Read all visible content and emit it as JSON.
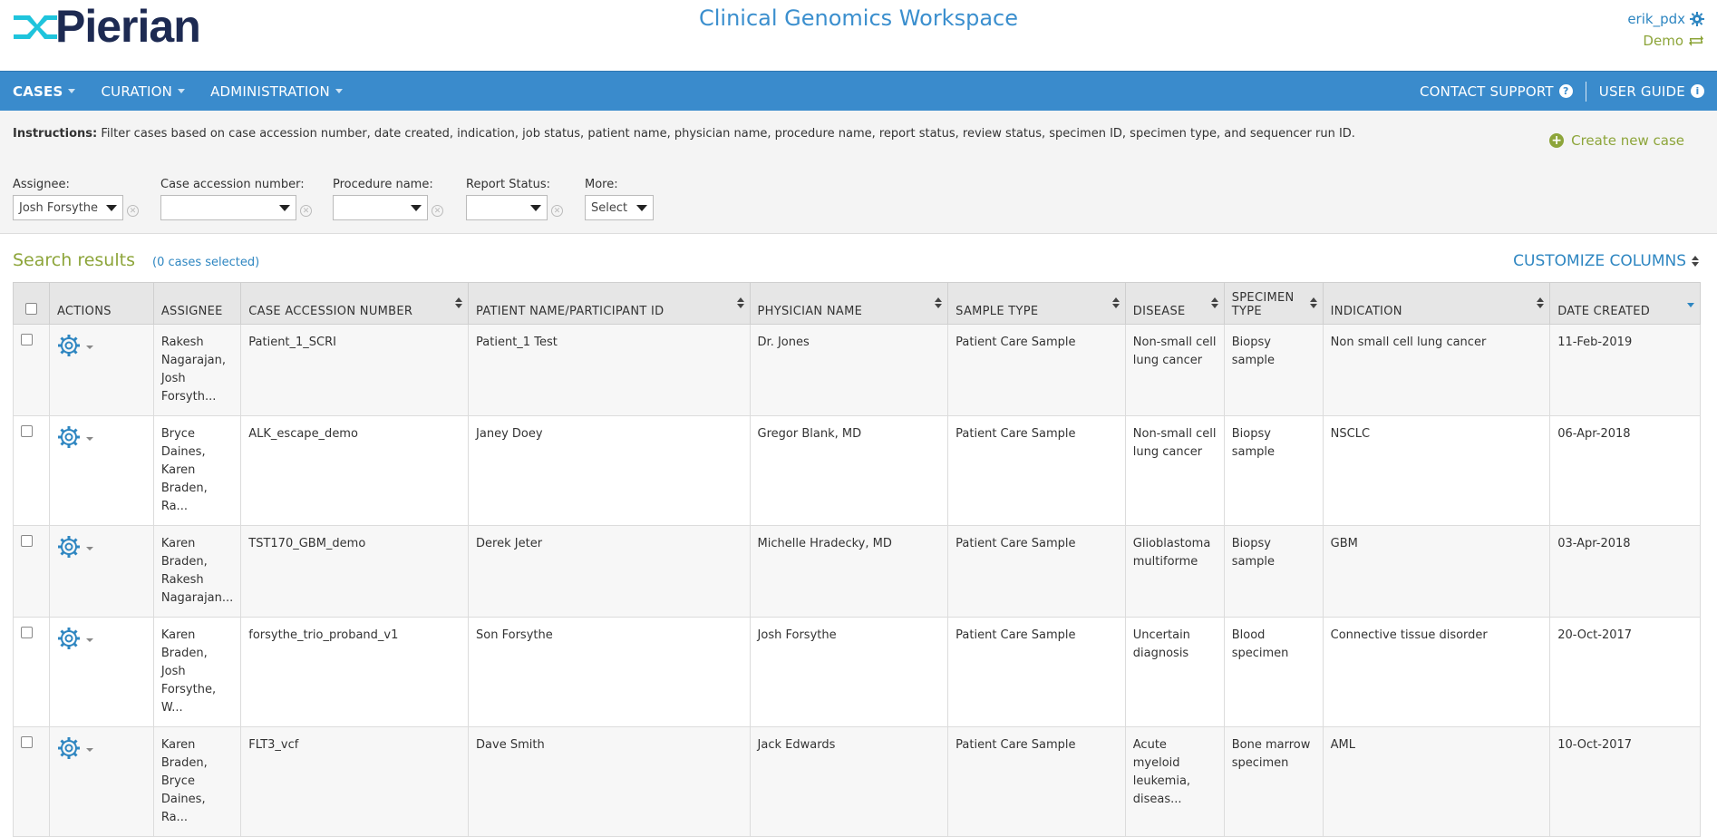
{
  "header": {
    "logo_text": "Pierian",
    "app_title": "Clinical Genomics Workspace",
    "username": "erik_pdx",
    "org": "Demo"
  },
  "nav": {
    "left": [
      {
        "label": "CASES",
        "active": true
      },
      {
        "label": "CURATION",
        "active": false
      },
      {
        "label": "ADMINISTRATION",
        "active": false
      }
    ],
    "contact_support": "CONTACT SUPPORT",
    "user_guide": "USER GUIDE"
  },
  "filters": {
    "instructions_label": "Instructions:",
    "instructions_text": "Filter cases based on case accession number, date created, indication, job status, patient name, physician name, procedure name, report status, review status, specimen ID, specimen type, and sequencer run ID.",
    "create_new": "Create new case",
    "assignee_label": "Assignee:",
    "assignee_value": "Josh Forsythe",
    "accession_label": "Case accession number:",
    "accession_value": "",
    "procedure_label": "Procedure name:",
    "procedure_value": "",
    "report_label": "Report Status:",
    "report_value": "",
    "more_label": "More:",
    "more_value": "Select"
  },
  "results": {
    "title": "Search results",
    "selected": "(0 cases selected)",
    "customize": "CUSTOMIZE COLUMNS"
  },
  "table": {
    "headers": {
      "actions": "ACTIONS",
      "assignee": "ASSIGNEE",
      "accession": "CASE ACCESSION NUMBER",
      "patient": "PATIENT NAME/PARTICIPANT ID",
      "physician": "PHYSICIAN NAME",
      "sample": "SAMPLE TYPE",
      "disease": "DISEASE",
      "specimen": "SPECIMEN TYPE",
      "indication": "INDICATION",
      "date": "DATE CREATED"
    },
    "rows": [
      {
        "assignee": "Rakesh Nagarajan, Josh Forsyth...",
        "accession": "Patient_1_SCRI",
        "patient": "Patient_1 Test",
        "physician": "Dr. Jones",
        "sample": "Patient Care Sample",
        "disease": "Non-small cell lung cancer",
        "specimen": "Biopsy sample",
        "indication": "Non small cell lung cancer",
        "date": "11-Feb-2019"
      },
      {
        "assignee": "Bryce Daines, Karen Braden, Ra...",
        "accession": "ALK_escape_demo",
        "patient": "Janey Doey",
        "physician": "Gregor Blank, MD",
        "sample": "Patient Care Sample",
        "disease": "Non-small cell lung cancer",
        "specimen": "Biopsy sample",
        "indication": "NSCLC",
        "date": "06-Apr-2018"
      },
      {
        "assignee": "Karen Braden, Rakesh Nagarajan...",
        "accession": "TST170_GBM_demo",
        "patient": "Derek Jeter",
        "physician": "Michelle Hradecky, MD",
        "sample": "Patient Care Sample",
        "disease": "Glioblastoma multiforme",
        "specimen": "Biopsy sample",
        "indication": "GBM",
        "date": "03-Apr-2018"
      },
      {
        "assignee": "Karen Braden, Josh Forsythe, W...",
        "accession": "forsythe_trio_proband_v1",
        "patient": "Son Forsythe",
        "physician": "Josh Forsythe",
        "sample": "Patient Care Sample",
        "disease": "Uncertain diagnosis",
        "specimen": "Blood specimen",
        "indication": "Connective tissue disorder",
        "date": "20-Oct-2017"
      },
      {
        "assignee": "Karen Braden, Bryce Daines, Ra...",
        "accession": "FLT3_vcf",
        "patient": "Dave Smith",
        "physician": "Jack Edwards",
        "sample": "Patient Care Sample",
        "disease": "Acute myeloid leukemia, diseas...",
        "specimen": "Bone marrow specimen",
        "indication": "AML",
        "date": "10-Oct-2017"
      }
    ]
  },
  "colors": {
    "navbar": "#3a8bcc",
    "accent_green": "#8da53a",
    "link_blue": "#2e86c1",
    "logo_navy": "#1d2a52",
    "logo_cyan": "#1fc4dc"
  }
}
